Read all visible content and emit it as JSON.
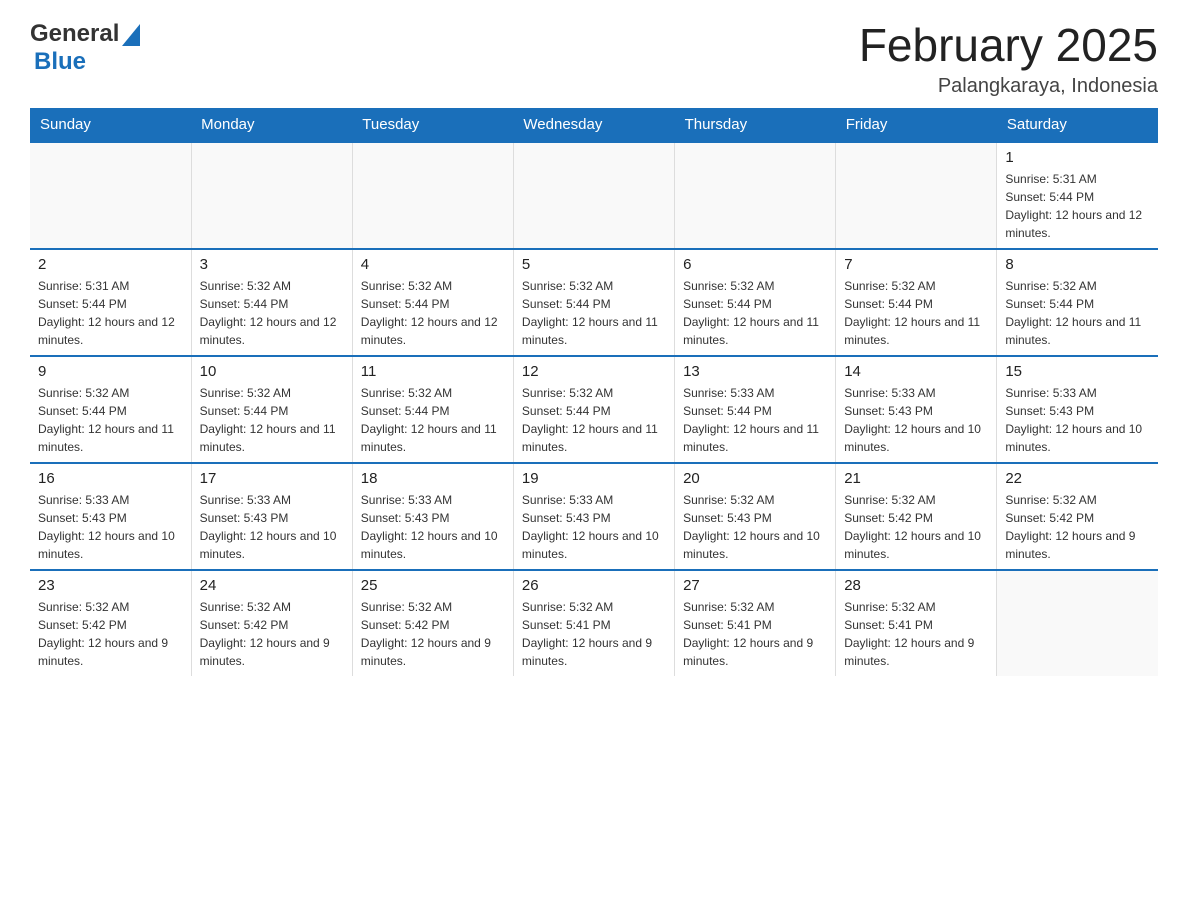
{
  "logo": {
    "general": "General",
    "blue": "Blue"
  },
  "header": {
    "title": "February 2025",
    "location": "Palangkaraya, Indonesia"
  },
  "weekdays": [
    "Sunday",
    "Monday",
    "Tuesday",
    "Wednesday",
    "Thursday",
    "Friday",
    "Saturday"
  ],
  "weeks": [
    {
      "days": [
        {
          "num": "",
          "info": ""
        },
        {
          "num": "",
          "info": ""
        },
        {
          "num": "",
          "info": ""
        },
        {
          "num": "",
          "info": ""
        },
        {
          "num": "",
          "info": ""
        },
        {
          "num": "",
          "info": ""
        },
        {
          "num": "1",
          "info": "Sunrise: 5:31 AM\nSunset: 5:44 PM\nDaylight: 12 hours and 12 minutes."
        }
      ]
    },
    {
      "days": [
        {
          "num": "2",
          "info": "Sunrise: 5:31 AM\nSunset: 5:44 PM\nDaylight: 12 hours and 12 minutes."
        },
        {
          "num": "3",
          "info": "Sunrise: 5:32 AM\nSunset: 5:44 PM\nDaylight: 12 hours and 12 minutes."
        },
        {
          "num": "4",
          "info": "Sunrise: 5:32 AM\nSunset: 5:44 PM\nDaylight: 12 hours and 12 minutes."
        },
        {
          "num": "5",
          "info": "Sunrise: 5:32 AM\nSunset: 5:44 PM\nDaylight: 12 hours and 11 minutes."
        },
        {
          "num": "6",
          "info": "Sunrise: 5:32 AM\nSunset: 5:44 PM\nDaylight: 12 hours and 11 minutes."
        },
        {
          "num": "7",
          "info": "Sunrise: 5:32 AM\nSunset: 5:44 PM\nDaylight: 12 hours and 11 minutes."
        },
        {
          "num": "8",
          "info": "Sunrise: 5:32 AM\nSunset: 5:44 PM\nDaylight: 12 hours and 11 minutes."
        }
      ]
    },
    {
      "days": [
        {
          "num": "9",
          "info": "Sunrise: 5:32 AM\nSunset: 5:44 PM\nDaylight: 12 hours and 11 minutes."
        },
        {
          "num": "10",
          "info": "Sunrise: 5:32 AM\nSunset: 5:44 PM\nDaylight: 12 hours and 11 minutes."
        },
        {
          "num": "11",
          "info": "Sunrise: 5:32 AM\nSunset: 5:44 PM\nDaylight: 12 hours and 11 minutes."
        },
        {
          "num": "12",
          "info": "Sunrise: 5:32 AM\nSunset: 5:44 PM\nDaylight: 12 hours and 11 minutes."
        },
        {
          "num": "13",
          "info": "Sunrise: 5:33 AM\nSunset: 5:44 PM\nDaylight: 12 hours and 11 minutes."
        },
        {
          "num": "14",
          "info": "Sunrise: 5:33 AM\nSunset: 5:43 PM\nDaylight: 12 hours and 10 minutes."
        },
        {
          "num": "15",
          "info": "Sunrise: 5:33 AM\nSunset: 5:43 PM\nDaylight: 12 hours and 10 minutes."
        }
      ]
    },
    {
      "days": [
        {
          "num": "16",
          "info": "Sunrise: 5:33 AM\nSunset: 5:43 PM\nDaylight: 12 hours and 10 minutes."
        },
        {
          "num": "17",
          "info": "Sunrise: 5:33 AM\nSunset: 5:43 PM\nDaylight: 12 hours and 10 minutes."
        },
        {
          "num": "18",
          "info": "Sunrise: 5:33 AM\nSunset: 5:43 PM\nDaylight: 12 hours and 10 minutes."
        },
        {
          "num": "19",
          "info": "Sunrise: 5:33 AM\nSunset: 5:43 PM\nDaylight: 12 hours and 10 minutes."
        },
        {
          "num": "20",
          "info": "Sunrise: 5:32 AM\nSunset: 5:43 PM\nDaylight: 12 hours and 10 minutes."
        },
        {
          "num": "21",
          "info": "Sunrise: 5:32 AM\nSunset: 5:42 PM\nDaylight: 12 hours and 10 minutes."
        },
        {
          "num": "22",
          "info": "Sunrise: 5:32 AM\nSunset: 5:42 PM\nDaylight: 12 hours and 9 minutes."
        }
      ]
    },
    {
      "days": [
        {
          "num": "23",
          "info": "Sunrise: 5:32 AM\nSunset: 5:42 PM\nDaylight: 12 hours and 9 minutes."
        },
        {
          "num": "24",
          "info": "Sunrise: 5:32 AM\nSunset: 5:42 PM\nDaylight: 12 hours and 9 minutes."
        },
        {
          "num": "25",
          "info": "Sunrise: 5:32 AM\nSunset: 5:42 PM\nDaylight: 12 hours and 9 minutes."
        },
        {
          "num": "26",
          "info": "Sunrise: 5:32 AM\nSunset: 5:41 PM\nDaylight: 12 hours and 9 minutes."
        },
        {
          "num": "27",
          "info": "Sunrise: 5:32 AM\nSunset: 5:41 PM\nDaylight: 12 hours and 9 minutes."
        },
        {
          "num": "28",
          "info": "Sunrise: 5:32 AM\nSunset: 5:41 PM\nDaylight: 12 hours and 9 minutes."
        },
        {
          "num": "",
          "info": ""
        }
      ]
    }
  ]
}
